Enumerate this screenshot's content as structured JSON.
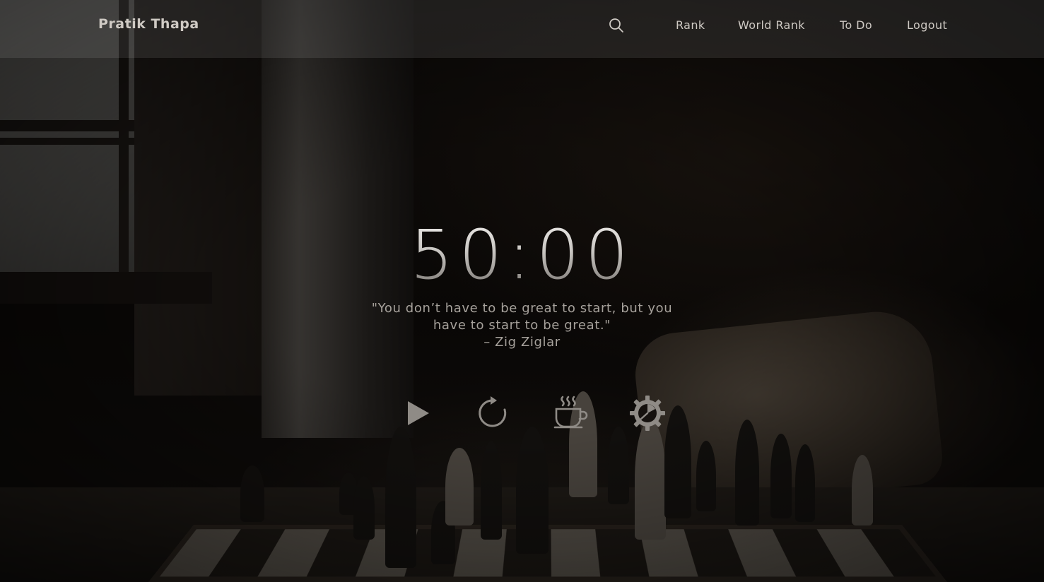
{
  "header": {
    "brand": "Pratik Thapa",
    "search_icon": "search-icon",
    "nav": [
      {
        "label": "Rank"
      },
      {
        "label": "World Rank"
      },
      {
        "label": "To Do"
      },
      {
        "label": "Logout"
      }
    ]
  },
  "timer": {
    "display": "50:00"
  },
  "quote": {
    "line1": "\"You don’t have to be great to start, but you",
    "line2": "have to start to be great.\"",
    "author": "– Zig Ziglar"
  },
  "controls": [
    {
      "icon": "play-icon"
    },
    {
      "icon": "reset-icon"
    },
    {
      "icon": "coffee-break-icon"
    },
    {
      "icon": "settings-timer-icon"
    }
  ],
  "colors": {
    "header_overlay": "rgba(255,255,255,0.09)",
    "text": "#cfcac4",
    "quote_text": "#a6a19b",
    "icon": "#8f8b86"
  }
}
